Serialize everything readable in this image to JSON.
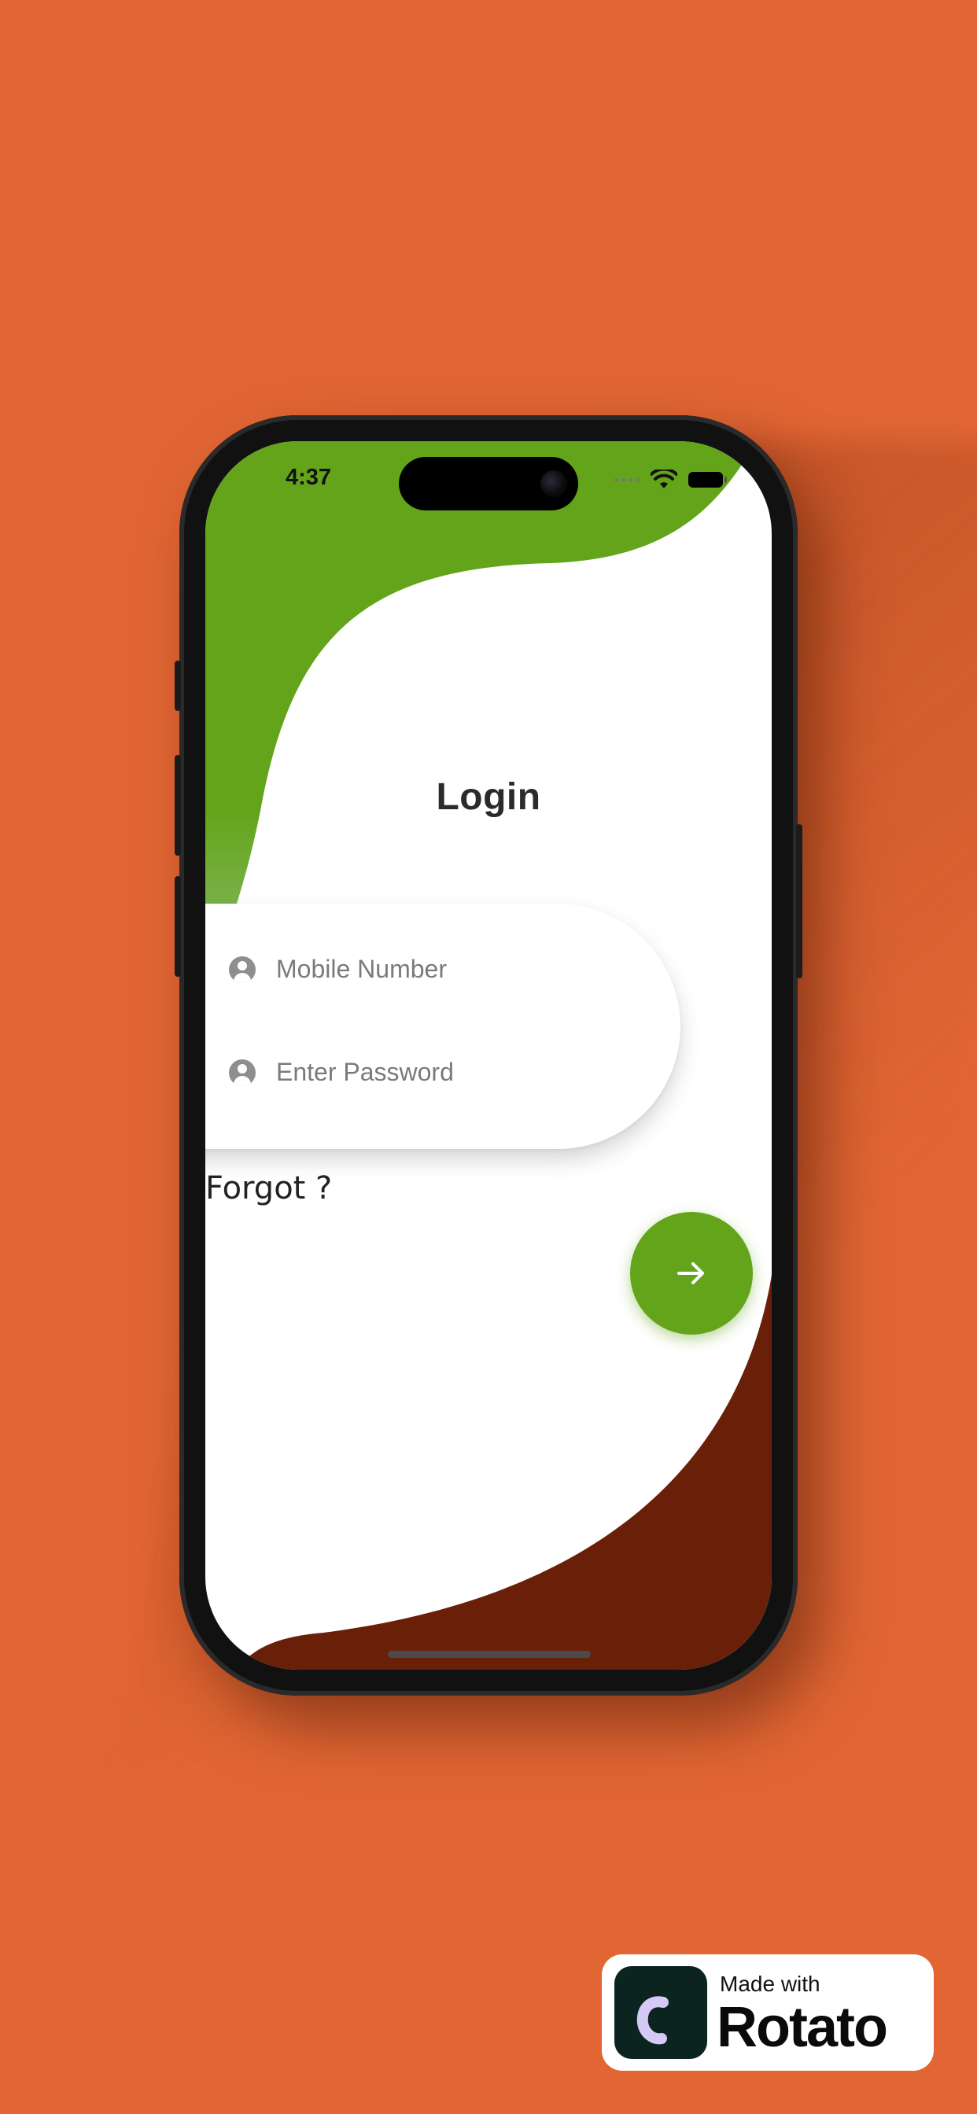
{
  "status_bar": {
    "time": "4:37"
  },
  "login": {
    "title": "Login",
    "mobile_placeholder": "Mobile Number",
    "password_placeholder": "Enter Password",
    "forgot_label": "Forgot ?",
    "submit_icon": "arrow-right-icon"
  },
  "badge": {
    "made_with": "Made with",
    "brand": "Rotato"
  },
  "colors": {
    "background": "#E26634",
    "accent_green": "#63A41A",
    "accent_brown": "#6A1F08",
    "screen": "#FFFFFF"
  }
}
